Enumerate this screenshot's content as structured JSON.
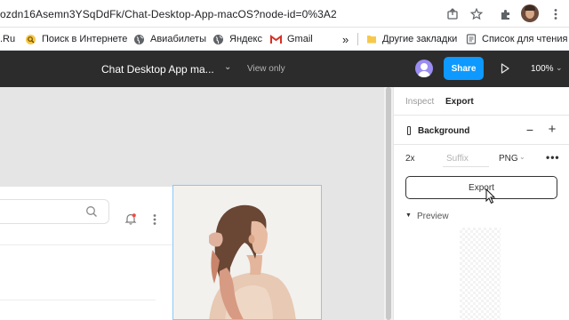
{
  "browser": {
    "url": "ozdn16Asemn3YSqDdFk/Chat-Desktop-App-macOS?node-id=0%3A2",
    "bookmarks": [
      {
        "label": ".Ru",
        "icon": "none"
      },
      {
        "label": "Поиск в Интернете",
        "icon": "search-globe-icon"
      },
      {
        "label": "Авиабилеты",
        "icon": "globe-icon"
      },
      {
        "label": "Яндекс",
        "icon": "globe-icon"
      },
      {
        "label": "Gmail",
        "icon": "gmail-icon"
      },
      {
        "label": "»",
        "icon": "overflow-chevron"
      },
      {
        "label": "Другие закладки",
        "icon": "folder-icon"
      },
      {
        "label": "Список для чтения",
        "icon": "reading-list-icon"
      }
    ]
  },
  "topbar": {
    "doc_title": "Chat Desktop App ma...",
    "view_mode": "View only",
    "share_label": "Share",
    "zoom": "100%"
  },
  "panel": {
    "tabs": [
      {
        "label": "Inspect",
        "active": false
      },
      {
        "label": "Export",
        "active": true
      }
    ],
    "background_label": "Background",
    "export": {
      "scale": "2x",
      "suffix_placeholder": "Suffix",
      "format": "PNG",
      "button_label": "Export"
    },
    "preview_label": "Preview"
  },
  "colors": {
    "topbar_bg": "#2c2c2c",
    "share_blue": "#0d99ff",
    "canvas_bg": "#e5e5e5",
    "selection_blue": "#8ec7f0",
    "avatar_purple": "#9b8df2"
  }
}
